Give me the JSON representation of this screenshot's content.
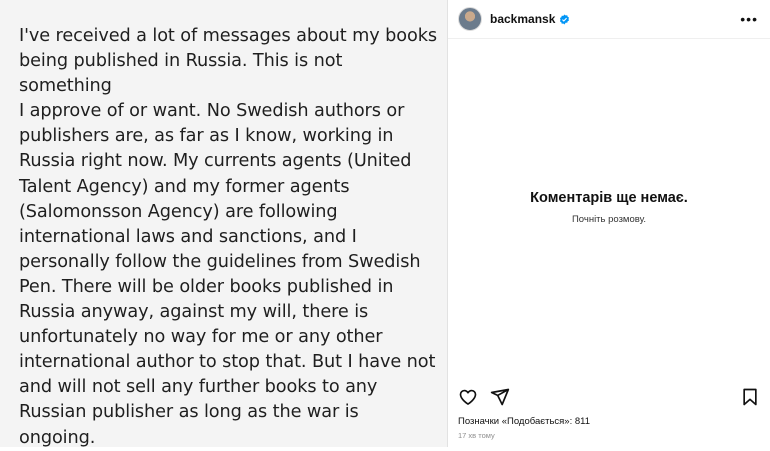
{
  "post": {
    "text_lines": [
      "I've received a lot of messages about my books",
      "being published in Russia. This is not something",
      "I approve of or want. No Swedish authors or",
      "publishers are, as far as I know, working in",
      "Russia right now. My currents agents (United",
      "Talent Agency) and my former agents",
      "(Salomonsson Agency) are following",
      "international laws and sanctions, and I",
      "personally follow the guidelines from Swedish",
      "Pen. There will be older books published in",
      "Russia anyway, against my will, there is",
      "unfortunately no way for me or any other",
      "international author to stop that. But I have not",
      "and will not sell any further books to any",
      "Russian publisher as long as the war is ongoing."
    ]
  },
  "header": {
    "username": "backmansk",
    "verified_icon": "verified-badge-icon",
    "more_icon": "more-options-icon"
  },
  "comments": {
    "empty_title": "Коментарів ще немає.",
    "empty_subtitle": "Почніть розмову."
  },
  "actions": {
    "like_icon": "heart-icon",
    "share_icon": "send-icon",
    "save_icon": "bookmark-icon"
  },
  "likes_text": "Позначки «Подобається»: 811",
  "time_text": "17 хв тому",
  "colors": {
    "verified": "#0095f6",
    "post_background": "#f4f4f4"
  }
}
